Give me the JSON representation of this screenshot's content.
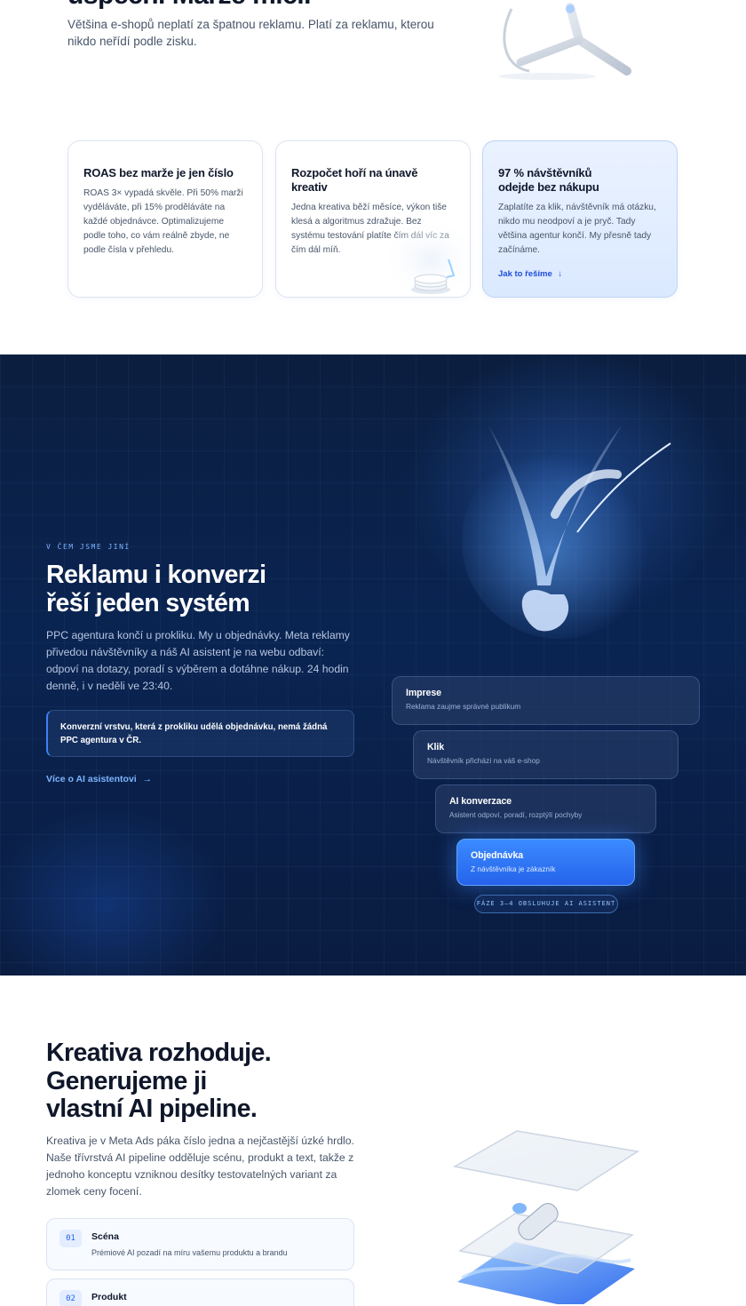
{
  "top": {
    "heading": "úspěch. Marže mlčí.",
    "subtitle": "Většina e-shopů neplatí za špatnou reklamu. Platí za reklamu, kterou nikdo neřídí podle zisku."
  },
  "cards": [
    {
      "title": "ROAS bez marže je jen číslo",
      "body": "ROAS 3× vypadá skvěle. Při 50% marži vyděláváte, při 15% proděláváte na každé objednávce. Optimalizujeme podle toho, co vám reálně zbyde, ne podle čísla v přehledu."
    },
    {
      "title": "Rozpočet hoří na únavě kreativ",
      "body": "Jedna kreativa běží měsíce, výkon tiše klesá a algoritmus zdražuje. Bez systému testování platíte čím dál víc za čím dál míň."
    },
    {
      "title_line1": "97 % návštěvníků",
      "title_line2": "odejde bez nákupu",
      "body": "Zaplatíte za klik, návštěvník má otázku, nikdo mu neodpoví a je pryč. Tady většina agentur končí. My přesně tady začínáme.",
      "link": "Jak to řešíme",
      "link_arrow": "↓"
    }
  ],
  "dark": {
    "eyebrow": "V ČEM JSME JINÍ",
    "heading_line1": "Reklamu i konverzi",
    "heading_line2": "řeší jeden systém",
    "subtitle": "PPC agentura končí u prokliku. My u objednávky. Meta reklamy přivedou návštěvníky a náš AI asistent je na webu odbaví: odpoví na dotazy, poradí s výběrem a dotáhne nákup. 24 hodin denně, i v neděli ve 23:40.",
    "callout": "Konverzní vrstvu, která z prokliku udělá objednávku, nemá žádná PPC agentura v ČR.",
    "link": "Více o AI asistentovi",
    "link_arrow": "→",
    "stages": [
      {
        "title": "Imprese",
        "desc": "Reklama zaujme správné publikum"
      },
      {
        "title": "Klik",
        "desc": "Návštěvník přichází na váš e-shop"
      },
      {
        "title": "AI konverzace",
        "desc": "Asistent odpoví, poradí, rozptýlí pochyby"
      },
      {
        "title": "Objednávka",
        "desc": "Z návštěvníka je zákazník"
      }
    ],
    "pill": "FÁZE 3–4 OBSLUHUJE AI ASISTENT"
  },
  "bottom": {
    "heading_line1": "Kreativa rozhoduje.",
    "heading_line2": "Generujeme ji",
    "heading_line3": "vlastní AI pipeline.",
    "subtitle": "Kreativa je v Meta Ads páka číslo jedna a nejčastější úzké hrdlo. Naše třívrstvá AI pipeline odděluje scénu, produkt a text, takže z jednoho konceptu vzniknou desítky testovatelných variant za zlomek ceny focení.",
    "steps": [
      {
        "num": "01",
        "title": "Scéna",
        "desc": "Prémiové AI pozadí na míru vašemu produktu a brandu"
      },
      {
        "num": "02",
        "title": "Produkt",
        "desc": ""
      }
    ]
  },
  "colors": {
    "accent": "#2563eb",
    "dark_bg": "#0a2452",
    "link_light": "#7db4ff"
  }
}
